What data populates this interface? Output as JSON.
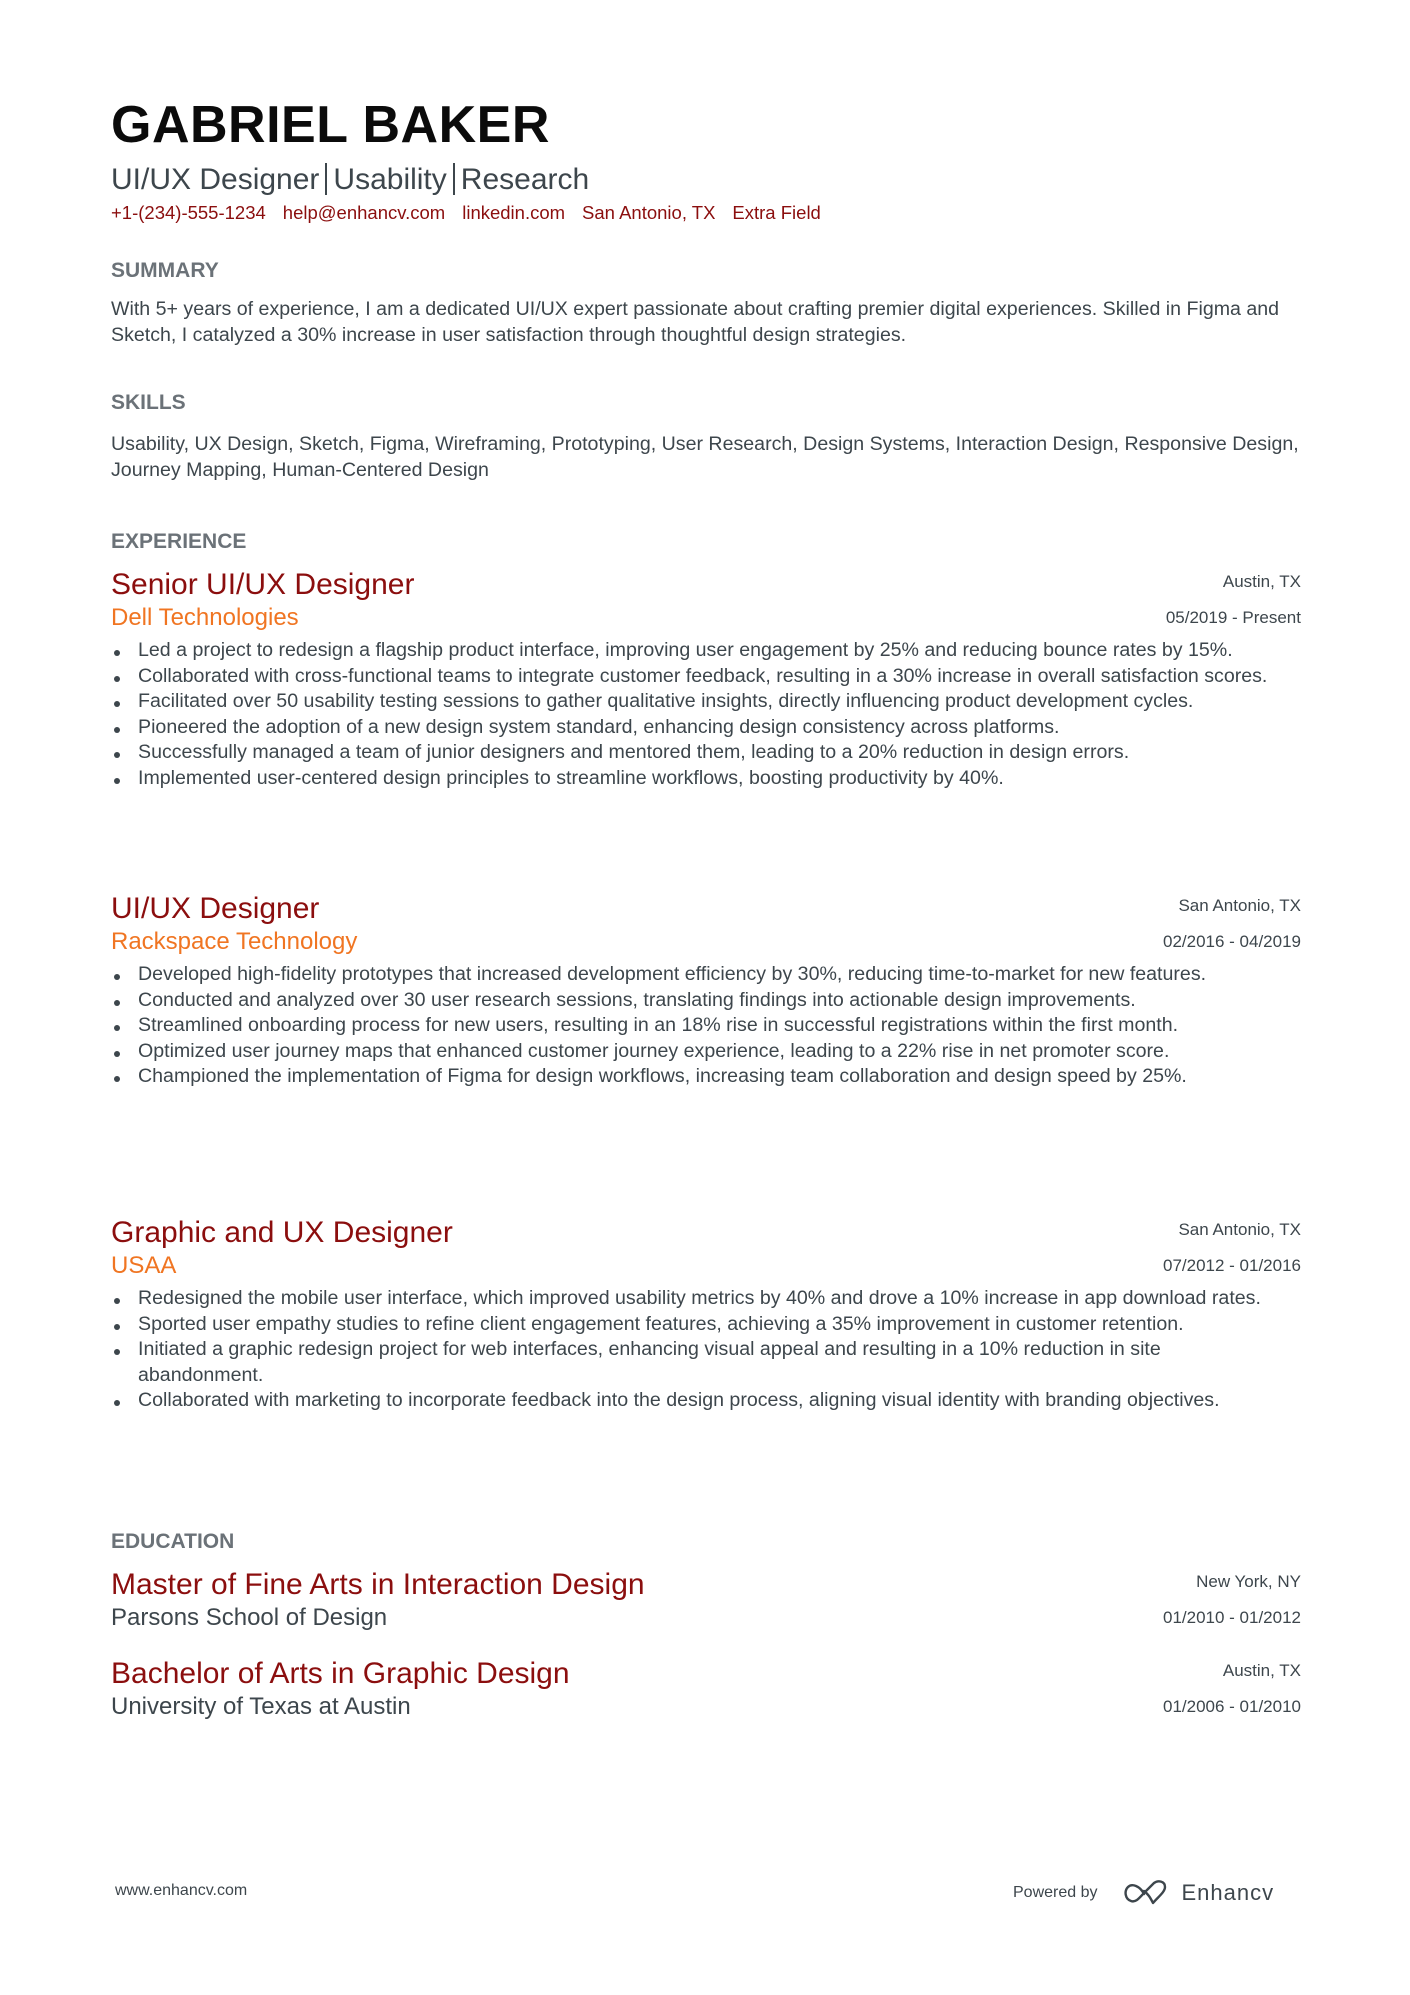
{
  "header": {
    "name": "GABRIEL BAKER",
    "headline_parts": [
      "UI/UX Designer",
      "Usability",
      "Research"
    ],
    "contacts": {
      "phone": "+1-(234)-555-1234",
      "email": "help@enhancv.com",
      "linkedin": "linkedin.com",
      "location": "San Antonio, TX",
      "extra": "Extra Field"
    }
  },
  "summary": {
    "title": "SUMMARY",
    "text": "With 5+ years of experience, I am a dedicated UI/UX expert passionate about crafting premier digital experiences. Skilled in Figma and Sketch, I catalyzed a 30% increase in user satisfaction through thoughtful design strategies."
  },
  "skills": {
    "title": "SKILLS",
    "text": "Usability, UX Design, Sketch, Figma, Wireframing, Prototyping, User Research, Design Systems, Interaction Design, Responsive Design, Journey Mapping, Human-Centered Design"
  },
  "experience": {
    "title": "EXPERIENCE",
    "jobs": [
      {
        "title": "Senior UI/UX Designer",
        "company": "Dell Technologies",
        "location": "Austin, TX",
        "dates": "05/2019 - Present",
        "bullets": [
          "Led a project to redesign a flagship product interface, improving user engagement by 25% and reducing bounce rates by 15%.",
          "Collaborated with cross-functional teams to integrate customer feedback, resulting in a 30% increase in overall satisfaction scores.",
          "Facilitated over 50 usability testing sessions to gather qualitative insights, directly influencing product development cycles.",
          "Pioneered the adoption of a new design system standard, enhancing design consistency across platforms.",
          "Successfully managed a team of junior designers and mentored them, leading to a 20% reduction in design errors.",
          "Implemented user-centered design principles to streamline workflows, boosting productivity by 40%."
        ]
      },
      {
        "title": "UI/UX Designer",
        "company": "Rackspace Technology",
        "location": "San Antonio, TX",
        "dates": "02/2016 - 04/2019",
        "bullets": [
          "Developed high-fidelity prototypes that increased development efficiency by 30%, reducing time-to-market for new features.",
          "Conducted and analyzed over 30 user research sessions, translating findings into actionable design improvements.",
          "Streamlined onboarding process for new users, resulting in an 18% rise in successful registrations within the first month.",
          "Optimized user journey maps that enhanced customer journey experience, leading to a 22% rise in net promoter score.",
          "Championed the implementation of Figma for design workflows, increasing team collaboration and design speed by 25%."
        ]
      },
      {
        "title": "Graphic and UX Designer",
        "company": "USAA",
        "location": "San Antonio, TX",
        "dates": "07/2012 - 01/2016",
        "bullets": [
          "Redesigned the mobile user interface, which improved usability metrics by 40% and drove a 10% increase in app download rates.",
          "Sported user empathy studies to refine client engagement features, achieving a 35% improvement in customer retention.",
          "Initiated a graphic redesign project for web interfaces, enhancing visual appeal and resulting in a 10% reduction in site abandonment.",
          "Collaborated with marketing to incorporate feedback into the design process, aligning visual identity with branding objectives."
        ]
      }
    ]
  },
  "education": {
    "title": "EDUCATION",
    "items": [
      {
        "degree": "Master of Fine Arts in Interaction Design",
        "school": "Parsons School of Design",
        "location": "New York, NY",
        "dates": "01/2010 - 01/2012"
      },
      {
        "degree": "Bachelor of Arts in Graphic Design",
        "school": "University of Texas at Austin",
        "location": "Austin, TX",
        "dates": "01/2006 - 01/2010"
      }
    ]
  },
  "footer": {
    "website": "www.enhancv.com",
    "powered_by": "Powered by",
    "brand": "Enhancv",
    "logo_icon": "enhancv-logo-icon"
  },
  "colors": {
    "accent_title": "#8b0e0e",
    "accent_company": "#f07522",
    "section_header": "#6b7278",
    "body_text": "#3d464c",
    "name": "#0b0b0b"
  }
}
